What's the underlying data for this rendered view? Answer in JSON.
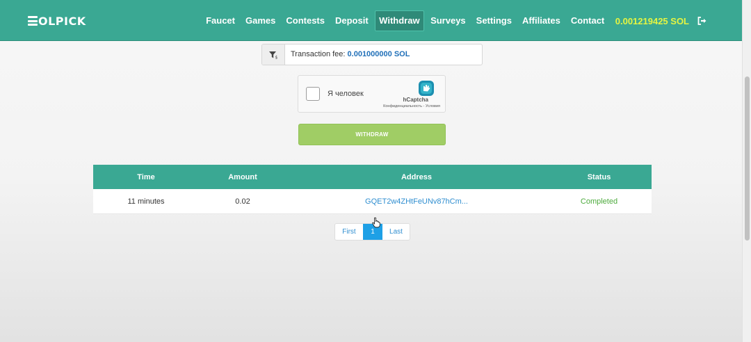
{
  "brand": {
    "logo_text": "OLPICK"
  },
  "nav": {
    "items": [
      "Faucet",
      "Games",
      "Contests",
      "Deposit",
      "Withdraw",
      "Surveys",
      "Settings",
      "Affiliates",
      "Contact"
    ],
    "active": "Withdraw",
    "balance": "0.001219425 SOL",
    "logout_icon": "sign-out-icon"
  },
  "fee": {
    "label": "Transaction fee:",
    "value": "0.001000000 SOL",
    "icon": "filter-dollar-icon"
  },
  "captcha": {
    "label": "Я человек",
    "brand": "hCaptcha",
    "links": "Конфиденциальность - Условия"
  },
  "withdraw_button": {
    "label": "WITHDRAW"
  },
  "history_table": {
    "headers": [
      "Time",
      "Amount",
      "Address",
      "Status"
    ],
    "rows": [
      {
        "time": "11 minutes",
        "amount": "0.02",
        "address": "GQET2w4ZHtFeUNv87hCm...",
        "status": "Completed"
      }
    ]
  },
  "pagination": {
    "first": "First",
    "current": "1",
    "last": "Last"
  },
  "colors": {
    "header_bg": "#3aa893",
    "balance": "#e6f541",
    "withdraw_btn": "#a0cd65",
    "link": "#2f8ed0",
    "status_completed": "#4caa3c",
    "page_active": "#1ea0e6"
  }
}
